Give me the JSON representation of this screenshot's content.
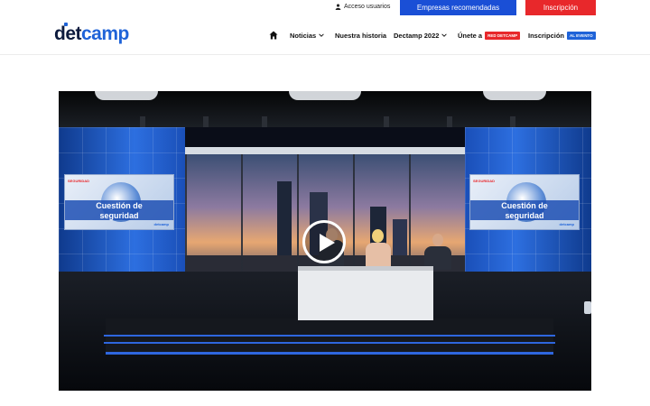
{
  "topbar": {
    "access_label": "Acceso usuarios",
    "empresas_label": "Empresas recomendadas",
    "inscripcion_label": "Inscripción"
  },
  "logo": {
    "part1": "det",
    "part2": "camp"
  },
  "nav": {
    "items": [
      {
        "label": "Noticias"
      },
      {
        "label": "Nuestra historia"
      },
      {
        "label": "Dectamp 2022"
      },
      {
        "label": "Únete a",
        "pill": "RED DETCAMP"
      },
      {
        "label": "Inscripción",
        "pill": "AL EVENTO"
      }
    ]
  },
  "video": {
    "screen_left": {
      "brand": "SEGURIDAD",
      "title1": "Cuestión de",
      "title2": "seguridad",
      "tag": "detcamp"
    },
    "screen_right": {
      "brand": "SEGURIDAD",
      "title1": "Cuestión de",
      "title2": "seguridad",
      "tag": "detcamp"
    }
  },
  "colors": {
    "accent_blue": "#1a4fd6",
    "accent_red": "#e8282b",
    "logo_dark": "#0d1b3e",
    "logo_blue": "#1f63d8"
  },
  "icons": [
    "user-icon",
    "home-icon",
    "chevron-down-icon",
    "play-icon"
  ]
}
